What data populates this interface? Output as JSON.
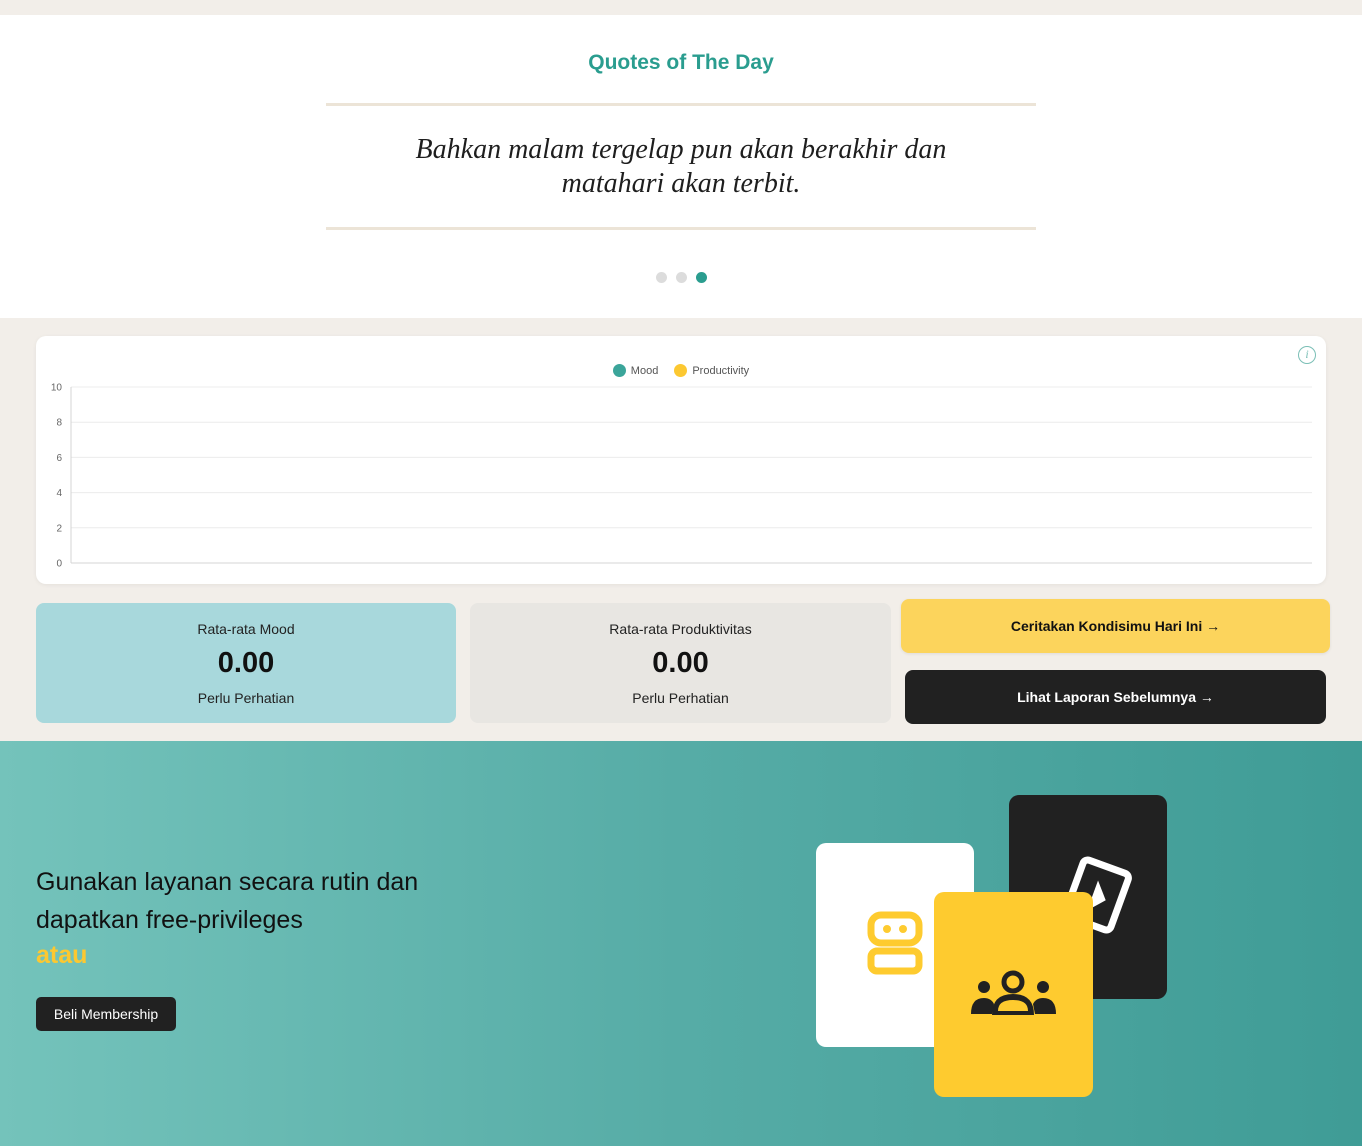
{
  "quote": {
    "title": "Quotes of The Day",
    "line1": "Bahkan malam tergelap pun akan berakhir dan",
    "line2": "matahari akan terbit.",
    "carousel": {
      "count": 3,
      "active_index": 2
    }
  },
  "chart_data": {
    "type": "line",
    "series": [
      {
        "name": "Mood",
        "color": "#3ba59a",
        "values": []
      },
      {
        "name": "Productivity",
        "color": "#fcc831",
        "values": []
      }
    ],
    "y_ticks": [
      "0",
      "2",
      "4",
      "6",
      "8",
      "10"
    ],
    "ylim": [
      0,
      10
    ],
    "grid": true,
    "legend_position": "top-center",
    "info_icon": "info-icon"
  },
  "stats": {
    "mood": {
      "label": "Rata-rata Mood",
      "value": "0.00",
      "status": "Perlu Perhatian"
    },
    "productivity": {
      "label": "Rata-rata Produktivitas",
      "value": "0.00",
      "status": "Perlu Perhatian"
    }
  },
  "actions": {
    "tell_condition": "Ceritakan Kondisimu Hari Ini →",
    "view_reports": "Lihat Laporan Sebelumnya →"
  },
  "promo": {
    "line1": "Gunakan layanan secara rutin dan",
    "line2": "dapatkan free-privileges",
    "atau": "atau",
    "button": "Beli Membership",
    "cards": [
      {
        "color": "#212121",
        "icon": "card-tilted-icon"
      },
      {
        "color": "#ffffff",
        "icon": "robot-icon"
      },
      {
        "color": "#fecb2f",
        "icon": "group-icon"
      }
    ]
  },
  "colors": {
    "accent": "#2a9d8f",
    "yellow": "#fcd45c",
    "dark": "#212121",
    "background": "#f2eee9"
  }
}
